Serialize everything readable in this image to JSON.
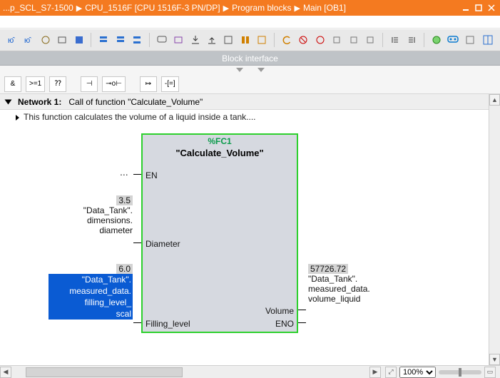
{
  "titlebar": {
    "crumbs": [
      "...p_SCL_S7-1500",
      "CPU_1516F [CPU 1516F-3 PN/DP]",
      "Program blocks",
      "Main [OB1]"
    ]
  },
  "block_interface_label": "Block interface",
  "ladbar": {
    "b0": "&",
    "b1": ">=1",
    "b2": "⁇",
    "b3": "⊣",
    "b4": "⊸o⊢",
    "b5": "↦",
    "b6": "-[=]"
  },
  "network": {
    "label": "Network 1:",
    "title": "Call of function \"Calculate_Volume\"",
    "description": "This function calculates the volume of a liquid inside a tank...."
  },
  "block": {
    "symbolic": "%FC1",
    "name": "\"Calculate_Volume\"",
    "pins": {
      "en": "EN",
      "diameter": "Diameter",
      "filling": "Filling_level",
      "volume": "Volume",
      "eno": "ENO"
    }
  },
  "inputs": {
    "diameter": {
      "value": "3.5",
      "line1": "\"Data_Tank\".",
      "line2": "dimensions.",
      "line3": "diameter"
    },
    "filling": {
      "value": "6.0",
      "line1": "\"Data_Tank\".",
      "line2": "measured_data.",
      "line3": "filling_level_",
      "line4": "scal"
    }
  },
  "outputs": {
    "volume": {
      "value": "57726.72",
      "line1": "\"Data_Tank\".",
      "line2": "measured_data.",
      "line3": "volume_liquid"
    }
  },
  "zoom": "100%"
}
